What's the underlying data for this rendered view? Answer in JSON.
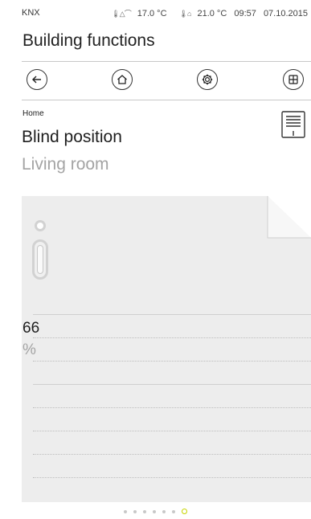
{
  "status_bar": {
    "app_name": "KNX",
    "outdoor_temp": "17.0 °C",
    "indoor_temp": "21.0 °C",
    "time": "09:57",
    "date": "07.10.2015"
  },
  "header": {
    "title": "Building functions"
  },
  "nav": {
    "buttons": [
      {
        "name": "back",
        "icon": "arrow-left-icon"
      },
      {
        "name": "home",
        "icon": "home-icon"
      },
      {
        "name": "settings",
        "icon": "gear-icon"
      },
      {
        "name": "grid",
        "icon": "grid-icon"
      }
    ]
  },
  "breadcrumb": "Home",
  "page": {
    "title": "Blind position",
    "subtitle": "Living room"
  },
  "control": {
    "value": "66",
    "unit": "%",
    "position_percent": 66
  },
  "pager": {
    "count": 7,
    "active_index": 6
  },
  "colors": {
    "accent": "#c7d400",
    "card": "#ededed",
    "muted_text": "#a4a4a4"
  }
}
